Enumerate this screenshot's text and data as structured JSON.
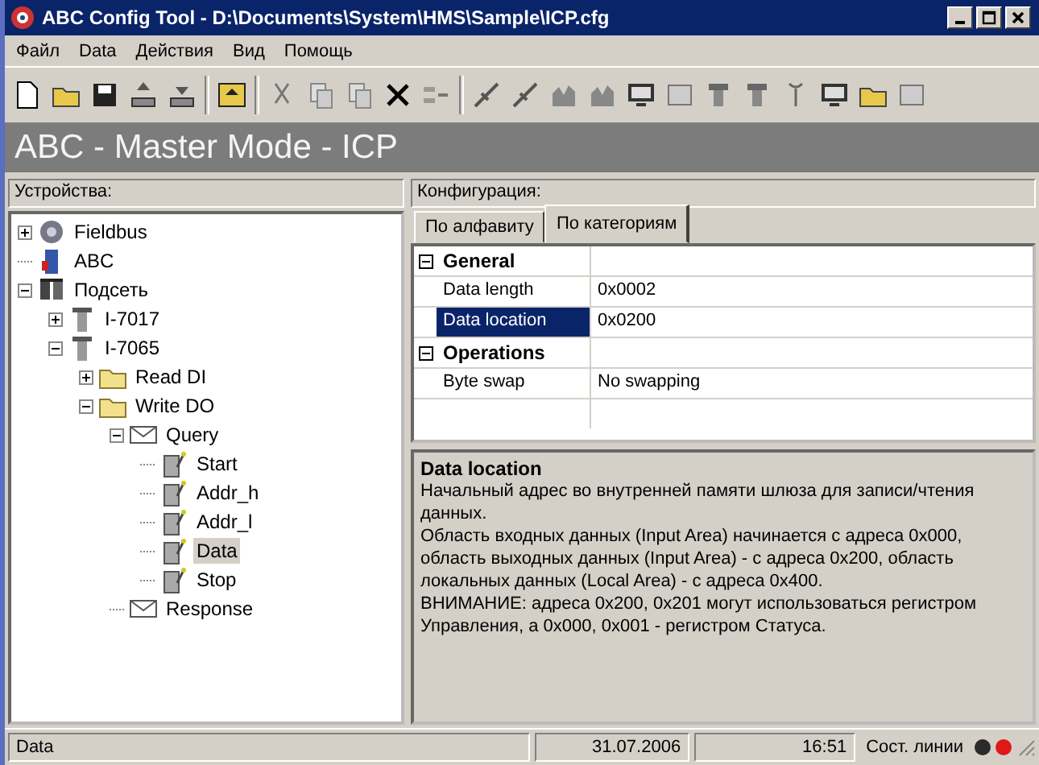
{
  "window": {
    "title": "ABC Config Tool - D:\\Documents\\System\\HMS\\Sample\\ICP.cfg"
  },
  "menu": [
    "Файл",
    "Data",
    "Действия",
    "Вид",
    "Помощь"
  ],
  "banner": "ABC - Master Mode - ICP",
  "devices": {
    "header": "Устройства:",
    "tree": [
      {
        "label": "Fieldbus",
        "kind": "network",
        "expanded": false,
        "selected": false
      },
      {
        "label": "ABC",
        "kind": "gateway",
        "selected": false
      },
      {
        "label": "Подсеть",
        "kind": "subnet",
        "expanded": true,
        "selected": false,
        "children": [
          {
            "label": "I-7017",
            "kind": "module",
            "expanded": false,
            "selected": false
          },
          {
            "label": "I-7065",
            "kind": "module",
            "expanded": true,
            "selected": false,
            "children": [
              {
                "label": "Read DI",
                "kind": "folder",
                "expanded": false,
                "selected": false
              },
              {
                "label": "Write DO",
                "kind": "folder",
                "expanded": true,
                "selected": false,
                "children": [
                  {
                    "label": "Query",
                    "kind": "message",
                    "expanded": true,
                    "selected": false,
                    "children": [
                      {
                        "label": "Start",
                        "kind": "tag",
                        "selected": false
                      },
                      {
                        "label": "Addr_h",
                        "kind": "tag",
                        "selected": false
                      },
                      {
                        "label": "Addr_l",
                        "kind": "tag",
                        "selected": false
                      },
                      {
                        "label": "Data",
                        "kind": "tag",
                        "selected": true
                      },
                      {
                        "label": "Stop",
                        "kind": "tag",
                        "selected": false
                      }
                    ]
                  },
                  {
                    "label": "Response",
                    "kind": "message",
                    "selected": false
                  }
                ]
              }
            ]
          }
        ]
      }
    ]
  },
  "config": {
    "header": "Конфигурация:",
    "tabs": [
      {
        "label": "По алфавиту",
        "selected": false
      },
      {
        "label": "По категориям",
        "selected": true
      }
    ],
    "categories": [
      {
        "name": "General",
        "expanded": true,
        "rows": [
          {
            "name": "Data length",
            "value": "0x0002",
            "selected": false
          },
          {
            "name": "Data location",
            "value": "0x0200",
            "selected": true
          }
        ]
      },
      {
        "name": "Operations",
        "expanded": true,
        "rows": [
          {
            "name": "Byte swap",
            "value": "No swapping",
            "selected": false
          }
        ]
      }
    ],
    "description": {
      "title": "Data location",
      "paragraphs": [
        "Начальный адрес во внутренней памяти шлюза для записи/чтения данных.",
        "Область входных данных (Input Area) начинается с адреса 0x000, область выходных данных (Input Area) - с адреса 0x200, область локальных данных (Local Area) - с адреса 0x400.",
        "ВНИМАНИЕ: адреса 0x200, 0x201 могут использоваться регистром Управления, а 0x000, 0x001 - регистром Статуса."
      ]
    }
  },
  "status_bar": {
    "item": "Data",
    "date": "31.07.2006",
    "time": "16:51",
    "line_label": "Сост. линии",
    "leds": [
      {
        "color": "#2a2a2a"
      },
      {
        "color": "#e01818"
      }
    ]
  }
}
